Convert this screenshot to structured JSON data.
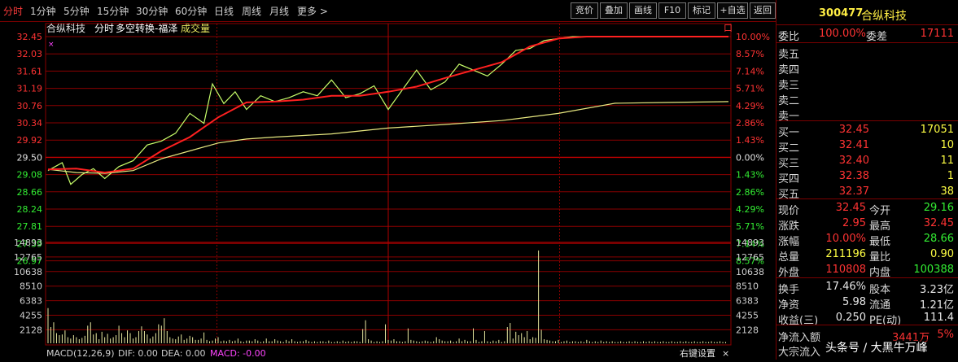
{
  "tabs": [
    "分时",
    "1分钟",
    "5分钟",
    "15分钟",
    "30分钟",
    "60分钟",
    "日线",
    "周线",
    "月线",
    "更多 >"
  ],
  "right_buttons": [
    "竞价",
    "叠加",
    "画线",
    "F10",
    "标记",
    "+自选",
    "返回"
  ],
  "chart_header": {
    "name": "合纵科技",
    "period": "分时",
    "indicator": "多空转换-福泽",
    "volume_label": "成交量"
  },
  "chart_data": {
    "type": "line",
    "price_ticks": [
      "32.45",
      "32.03",
      "31.61",
      "31.19",
      "30.76",
      "30.34",
      "29.92",
      "29.50",
      "29.08",
      "28.66",
      "28.24",
      "27.81",
      "27.39",
      "26.97"
    ],
    "pct_ticks": [
      "10.00%",
      "8.57%",
      "7.14%",
      "5.71%",
      "4.29%",
      "2.86%",
      "1.43%",
      "0.00%",
      "1.43%",
      "2.86%",
      "4.29%",
      "5.71%",
      "7.14%",
      "8.57%"
    ],
    "ylim": [
      26.76,
      32.45
    ],
    "prev_close": 29.5,
    "x_range": [
      0,
      240
    ],
    "series": [
      {
        "name": "price",
        "color": "#c8ff6a",
        "x": [
          0,
          5,
          8,
          12,
          16,
          20,
          25,
          30,
          35,
          40,
          45,
          50,
          55,
          58,
          62,
          66,
          70,
          75,
          80,
          85,
          90,
          95,
          100,
          105,
          110,
          115,
          120,
          125,
          130,
          135,
          140,
          145,
          150,
          155,
          160,
          165,
          170,
          175,
          180,
          185,
          190,
          195,
          200,
          205,
          210,
          215,
          220,
          225,
          230,
          235,
          240
        ],
        "y": [
          29.05,
          29.25,
          28.7,
          28.95,
          29.1,
          28.85,
          29.15,
          29.3,
          29.7,
          29.8,
          30.0,
          30.5,
          30.25,
          31.25,
          30.75,
          31.05,
          30.6,
          30.95,
          30.8,
          30.9,
          31.05,
          30.95,
          31.35,
          30.9,
          31.0,
          31.2,
          30.6,
          31.1,
          31.6,
          31.1,
          31.3,
          31.75,
          31.6,
          31.45,
          31.75,
          32.1,
          32.15,
          32.35,
          32.4,
          32.45,
          32.45,
          32.45,
          32.45,
          32.45,
          32.45,
          32.45,
          32.45,
          32.45,
          32.45,
          32.45,
          32.45
        ]
      },
      {
        "name": "avg",
        "color": "#e8e880",
        "x": [
          0,
          10,
          20,
          30,
          40,
          50,
          60,
          70,
          80,
          100,
          120,
          140,
          160,
          180,
          200,
          220,
          240
        ],
        "y": [
          29.08,
          29.0,
          28.98,
          29.05,
          29.35,
          29.55,
          29.75,
          29.85,
          29.9,
          29.98,
          30.13,
          30.22,
          30.32,
          30.5,
          30.76,
          30.78,
          30.8
        ]
      },
      {
        "name": "indicator",
        "color": "#ff2020",
        "x": [
          0,
          10,
          20,
          30,
          40,
          50,
          60,
          70,
          80,
          90,
          100,
          110,
          120,
          130,
          140,
          150,
          160,
          170,
          180,
          190,
          200,
          210,
          220,
          240
        ],
        "y": [
          29.08,
          29.1,
          29.0,
          29.1,
          29.55,
          29.9,
          30.4,
          30.78,
          30.8,
          30.85,
          30.95,
          30.95,
          31.05,
          31.18,
          31.4,
          31.6,
          31.8,
          32.2,
          32.4,
          32.45,
          32.45,
          32.45,
          32.45,
          32.45
        ]
      }
    ],
    "volume_ticks": [
      "14893",
      "12765",
      "10638",
      "8510",
      "6383",
      "4255",
      "2128"
    ],
    "volume_ylim": [
      0,
      14893
    ],
    "volume_values": [
      5200,
      2400,
      3100,
      1500,
      1200,
      1300,
      1900,
      900,
      700,
      1200,
      900,
      600,
      800,
      1100,
      2600,
      3100,
      1300,
      1500,
      600,
      1700,
      900,
      1400,
      700,
      900,
      1200,
      2600,
      1500,
      900,
      1900,
      1500,
      700,
      900,
      1800,
      2500,
      1800,
      1300,
      700,
      1000,
      1500,
      2800,
      2600,
      3700,
      1800,
      900,
      700,
      600,
      1000,
      1300,
      500,
      700,
      1100,
      900,
      500,
      500,
      700,
      1600,
      500,
      300,
      400,
      700,
      900,
      300,
      400,
      300,
      500,
      300,
      400,
      700,
      300,
      200,
      400,
      400,
      300,
      600,
      400,
      200,
      300,
      700,
      300,
      300,
      600,
      400,
      300,
      200,
      500,
      300,
      600,
      300,
      200,
      300,
      300,
      500,
      300,
      200,
      300,
      200,
      300,
      300,
      200,
      400,
      200,
      200,
      300,
      200,
      400,
      200,
      300,
      200,
      300,
      300,
      200,
      2100,
      3400,
      600,
      400,
      200,
      300,
      200,
      300,
      2800,
      500,
      400,
      600,
      300,
      300,
      200,
      300,
      2200,
      500,
      400,
      300,
      200,
      300,
      400,
      300,
      200,
      300,
      900,
      600,
      400,
      300,
      300,
      400,
      200,
      300,
      700,
      300,
      500,
      300,
      300,
      2200,
      500,
      200,
      300,
      1800,
      300,
      200,
      400,
      300,
      500,
      200,
      300,
      2400,
      3000,
      700,
      1700,
      1200,
      1500,
      900,
      1800,
      600,
      900,
      800,
      13700,
      2000,
      600,
      500,
      400,
      300,
      300,
      500,
      200,
      300,
      400,
      200,
      300,
      300,
      200,
      300,
      200,
      500,
      300,
      200,
      300,
      200,
      400,
      200,
      300,
      200,
      300,
      200,
      200,
      300,
      200,
      200,
      300,
      200,
      300,
      200,
      200,
      300,
      200,
      300,
      200,
      300,
      200,
      200,
      300,
      200,
      200,
      300,
      200,
      200,
      300,
      200,
      300,
      200,
      200,
      300,
      200,
      200,
      300,
      200,
      200,
      300,
      200,
      200,
      300,
      200,
      200
    ],
    "macd_label": "MACD(12,26,9)",
    "dif_label": "DIF: 0.00",
    "dea_label": "DEA: 0.00",
    "macd_val_label": "MACD: -0.00",
    "right_settings": "右键设置",
    "corner_box": "口"
  },
  "panel": {
    "code": "300477",
    "name": "合纵科技",
    "weibi_label": "委比",
    "weibi_val": "100.00%",
    "weicha_label": "委差",
    "weicha_val": "17111",
    "asks": [
      {
        "label": "卖五",
        "price": "",
        "vol": ""
      },
      {
        "label": "卖四",
        "price": "",
        "vol": ""
      },
      {
        "label": "卖三",
        "price": "",
        "vol": ""
      },
      {
        "label": "卖二",
        "price": "",
        "vol": ""
      },
      {
        "label": "卖一",
        "price": "",
        "vol": ""
      }
    ],
    "bids": [
      {
        "label": "买一",
        "price": "32.45",
        "vol": "17051"
      },
      {
        "label": "买二",
        "price": "32.41",
        "vol": "10"
      },
      {
        "label": "买三",
        "price": "32.40",
        "vol": "11"
      },
      {
        "label": "买四",
        "price": "32.38",
        "vol": "1"
      },
      {
        "label": "买五",
        "price": "32.37",
        "vol": "38"
      }
    ],
    "stats": [
      {
        "l1": "现价",
        "v1": "32.45",
        "c1": "red",
        "l2": "今开",
        "v2": "29.16",
        "c2": "grn"
      },
      {
        "l1": "涨跌",
        "v1": "2.95",
        "c1": "red",
        "l2": "最高",
        "v2": "32.45",
        "c2": "red"
      },
      {
        "l1": "涨幅",
        "v1": "10.00%",
        "c1": "red",
        "l2": "最低",
        "v2": "28.66",
        "c2": "grn"
      },
      {
        "l1": "总量",
        "v1": "211196",
        "c1": "yel",
        "l2": "量比",
        "v2": "0.90",
        "c2": "yel"
      },
      {
        "l1": "外盘",
        "v1": "110808",
        "c1": "red",
        "l2": "内盘",
        "v2": "100388",
        "c2": "grn"
      }
    ],
    "stats2": [
      {
        "l1": "换手",
        "v1": "17.46%",
        "l2": "股本",
        "v2": "3.23亿"
      },
      {
        "l1": "净资",
        "v1": "5.98",
        "l2": "流通",
        "v2": "1.21亿"
      },
      {
        "l1": "收益(三)",
        "v1": "0.250",
        "l2": "PE(动)",
        "v2": "111.4"
      }
    ],
    "flow1_label": "净流入额",
    "flow1_val": "3441万",
    "flow1_pct": "5%",
    "flow2_label": "大宗流入",
    "flow2_val": "",
    "flow2_pct": "",
    "watermark": "头条号 / 大黑牛万峰"
  }
}
